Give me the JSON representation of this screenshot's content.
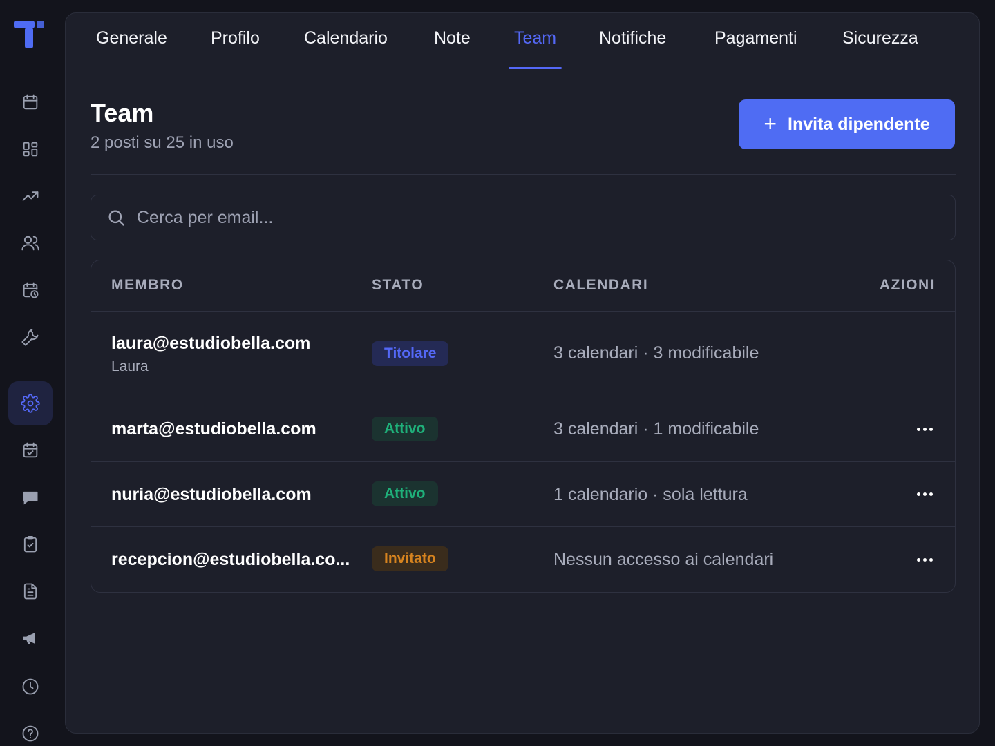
{
  "sidebar": {
    "logo": "app-logo",
    "icons": [
      {
        "name": "calendar-icon"
      },
      {
        "name": "dashboard-icon"
      },
      {
        "name": "trending-icon"
      },
      {
        "name": "users-icon"
      },
      {
        "name": "calendar-clock-icon"
      },
      {
        "name": "wrench-icon"
      },
      {
        "name": "settings-icon",
        "active": true
      },
      {
        "name": "calendar-check-icon"
      },
      {
        "name": "chat-icon"
      },
      {
        "name": "clipboard-check-icon"
      },
      {
        "name": "document-icon"
      },
      {
        "name": "megaphone-icon"
      },
      {
        "name": "clock-icon"
      },
      {
        "name": "help-icon"
      }
    ]
  },
  "tabs": [
    {
      "label": "Generale"
    },
    {
      "label": "Profilo"
    },
    {
      "label": "Calendario"
    },
    {
      "label": "Note"
    },
    {
      "label": "Team",
      "active": true
    },
    {
      "label": "Notifiche"
    },
    {
      "label": "Pagamenti"
    },
    {
      "label": "Sicurezza"
    }
  ],
  "page": {
    "title": "Team",
    "subtitle": "2 posti su 25 in uso",
    "invite_button": "Invita dipendente"
  },
  "search": {
    "placeholder": "Cerca per email..."
  },
  "table": {
    "headers": {
      "member": "MEMBRO",
      "status": "STATO",
      "calendars": "CALENDARI",
      "actions": "AZIONI"
    },
    "rows": [
      {
        "email": "laura@estudiobella.com",
        "name": "Laura",
        "status": "Titolare",
        "calendars": "3 calendari · 3 modificabile",
        "actions": false
      },
      {
        "email": "marta@estudiobella.com",
        "name": "",
        "status": "Attivo",
        "calendars": "3 calendari · 1 modificabile",
        "actions": true
      },
      {
        "email": "nuria@estudiobella.com",
        "name": "",
        "status": "Attivo",
        "calendars": "1 calendario · sola lettura",
        "actions": true
      },
      {
        "email": "recepcion@estudiobella.co...",
        "name": "",
        "status": "Invitato",
        "calendars": "Nessun accesso ai calendari",
        "actions": true
      }
    ]
  },
  "colors": {
    "accent": "#5468f6",
    "button": "#4f6cf3",
    "status_owner": "#5468f6",
    "status_active": "#1fb07a",
    "status_invited": "#d6831f"
  }
}
